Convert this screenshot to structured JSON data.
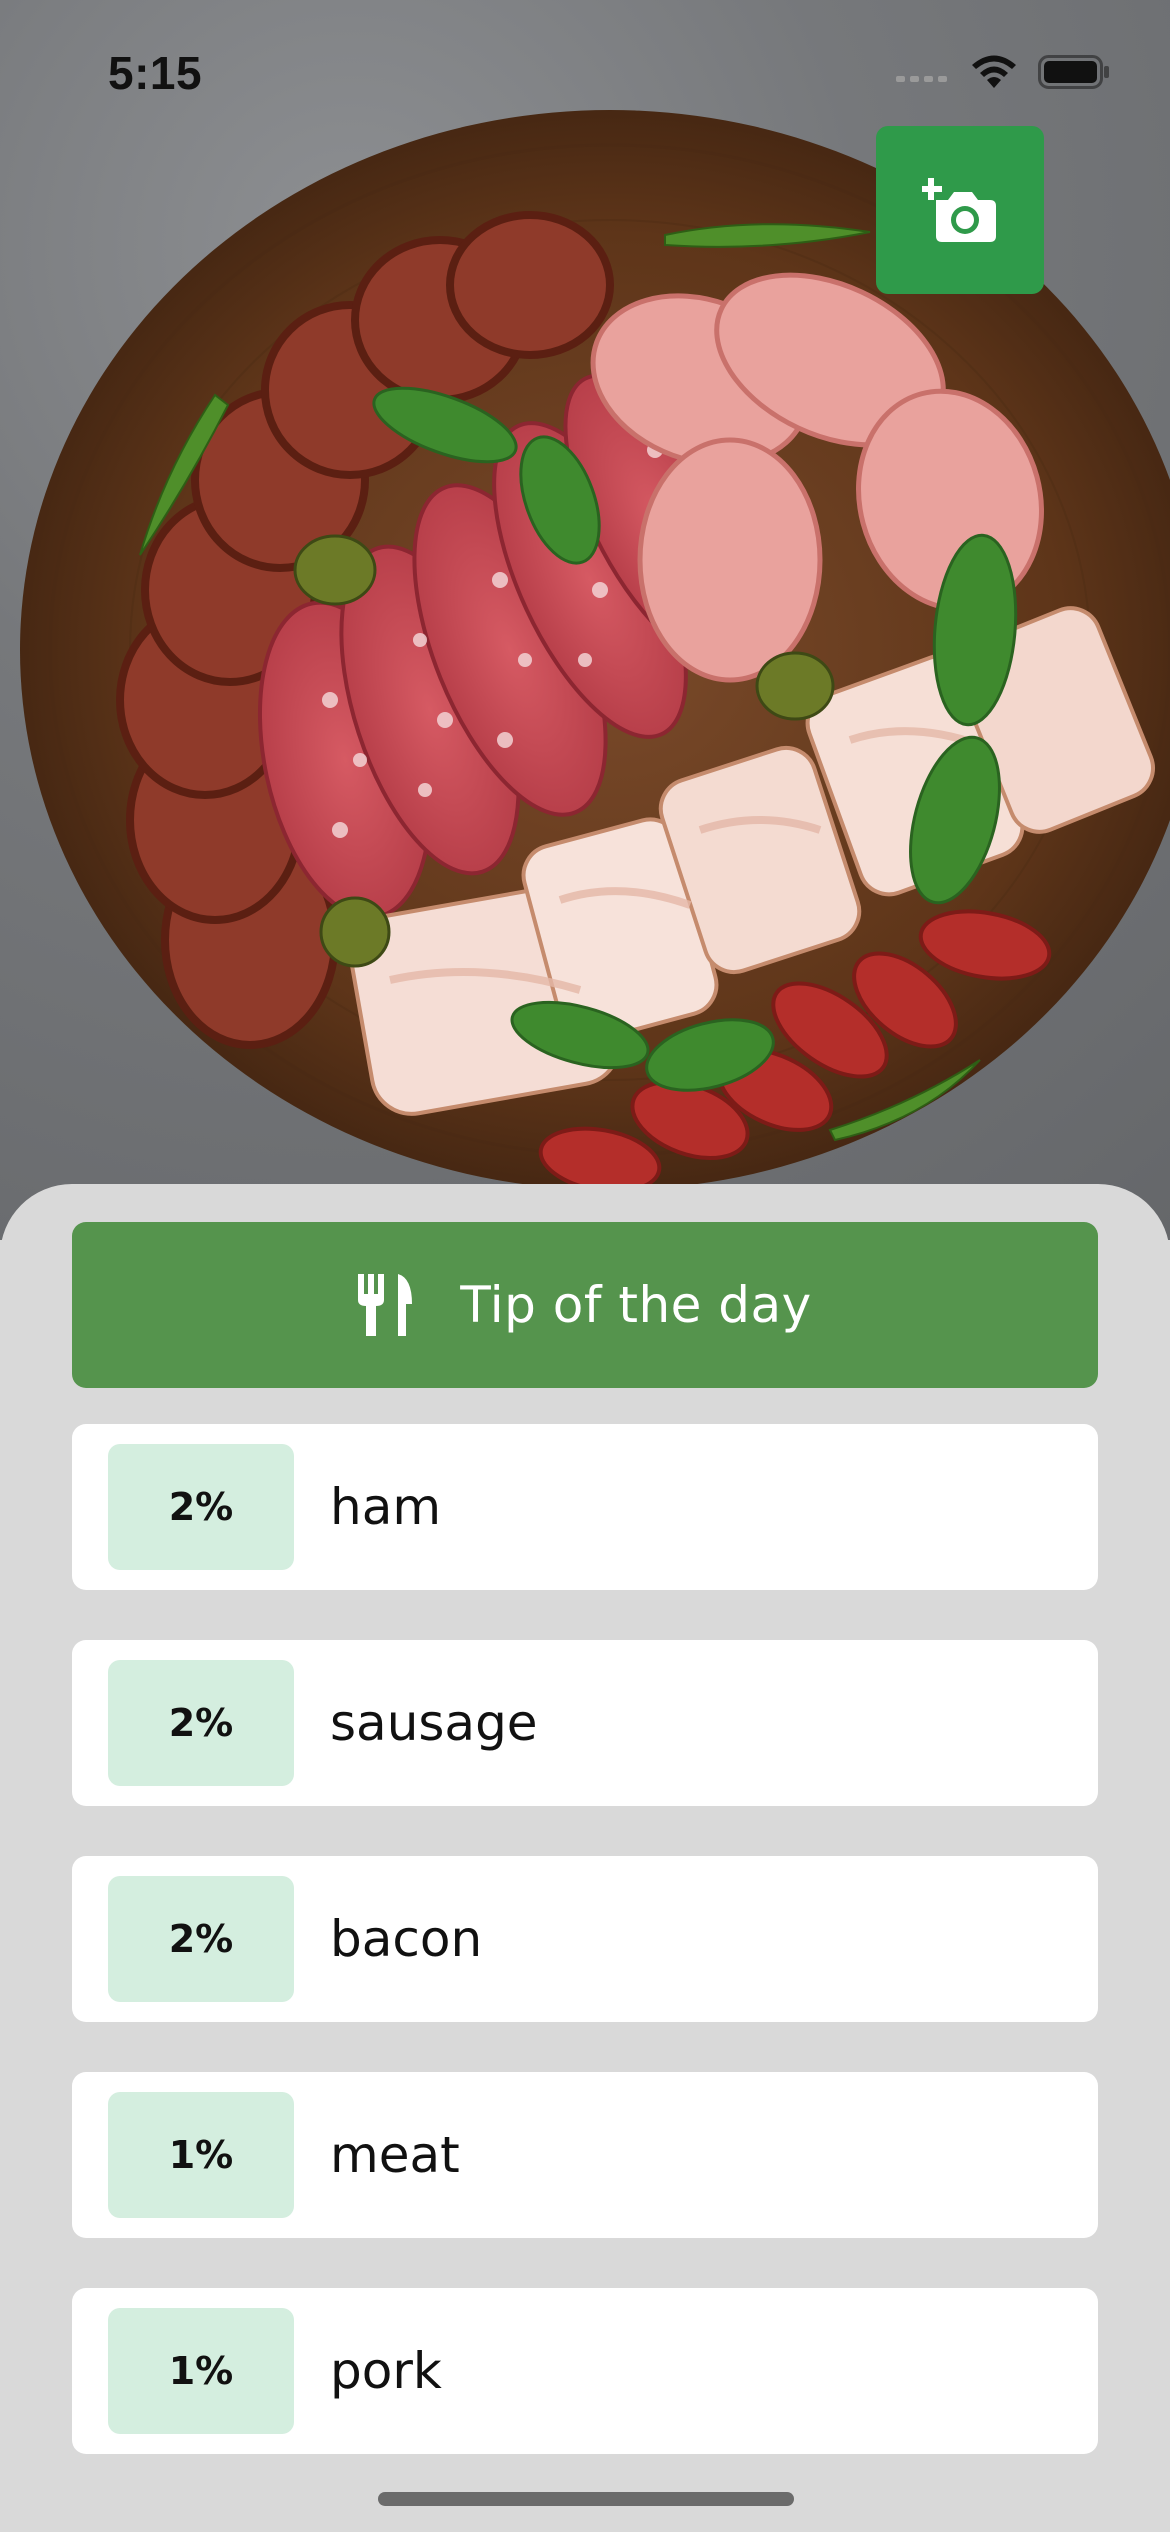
{
  "status_bar": {
    "time": "5:15",
    "icons": [
      "cellular-signal-icon",
      "wifi-icon",
      "battery-icon"
    ]
  },
  "photo": {
    "subject": "charcuterie-board-image"
  },
  "add_photo_button": {
    "icon": "add-photo-camera-icon",
    "color": "#2f9a4a"
  },
  "tip_button": {
    "label": "Tip of the day",
    "icon": "fork-knife-icon",
    "color": "#55944d"
  },
  "results": [
    {
      "percent": "2%",
      "label": "ham"
    },
    {
      "percent": "2%",
      "label": "sausage"
    },
    {
      "percent": "2%",
      "label": "bacon"
    },
    {
      "percent": "1%",
      "label": "meat"
    },
    {
      "percent": "1%",
      "label": "pork"
    }
  ],
  "colors": {
    "sheet_background": "#d9d9d9",
    "badge_background": "#d4eedf",
    "card_background": "#ffffff"
  }
}
